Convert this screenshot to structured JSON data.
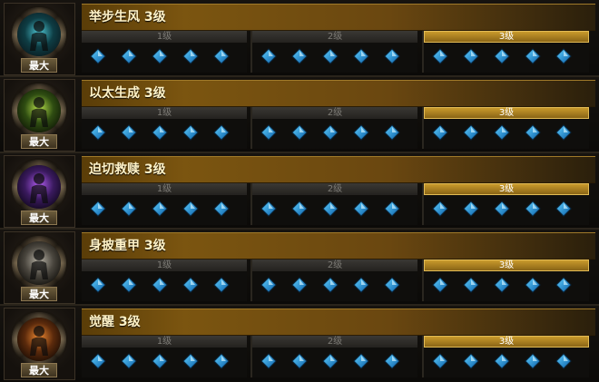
{
  "colors": {
    "gem_light": "#5fd0ff",
    "gem_dark": "#0b5fa8",
    "title_gold": "#7b5510",
    "active_tier": "#c99a2c"
  },
  "runes": [
    {
      "title": "举步生风 3级",
      "badge": "最大",
      "portrait_icon": "runner-portrait-icon",
      "tiers": [
        {
          "label": "1级",
          "active": false,
          "gems": 5
        },
        {
          "label": "2级",
          "active": false,
          "gems": 5
        },
        {
          "label": "3级",
          "active": true,
          "gems": 5
        }
      ]
    },
    {
      "title": "以太生成 3级",
      "badge": "最大",
      "portrait_icon": "ether-portrait-icon",
      "tiers": [
        {
          "label": "1级",
          "active": false,
          "gems": 5
        },
        {
          "label": "2级",
          "active": false,
          "gems": 5
        },
        {
          "label": "3级",
          "active": true,
          "gems": 5
        }
      ]
    },
    {
      "title": "迫切救赎 3级",
      "badge": "最大",
      "portrait_icon": "redemption-portrait-icon",
      "tiers": [
        {
          "label": "1级",
          "active": false,
          "gems": 5
        },
        {
          "label": "2级",
          "active": false,
          "gems": 5
        },
        {
          "label": "3级",
          "active": true,
          "gems": 5
        }
      ]
    },
    {
      "title": "身披重甲 3级",
      "badge": "最大",
      "portrait_icon": "armor-portrait-icon",
      "tiers": [
        {
          "label": "1级",
          "active": false,
          "gems": 5
        },
        {
          "label": "2级",
          "active": false,
          "gems": 5
        },
        {
          "label": "3级",
          "active": true,
          "gems": 5
        }
      ]
    },
    {
      "title": "觉醒 3级",
      "badge": "最大",
      "portrait_icon": "awaken-portrait-icon",
      "tiers": [
        {
          "label": "1级",
          "active": false,
          "gems": 5
        },
        {
          "label": "2级",
          "active": false,
          "gems": 5
        },
        {
          "label": "3级",
          "active": true,
          "gems": 5
        }
      ]
    }
  ]
}
